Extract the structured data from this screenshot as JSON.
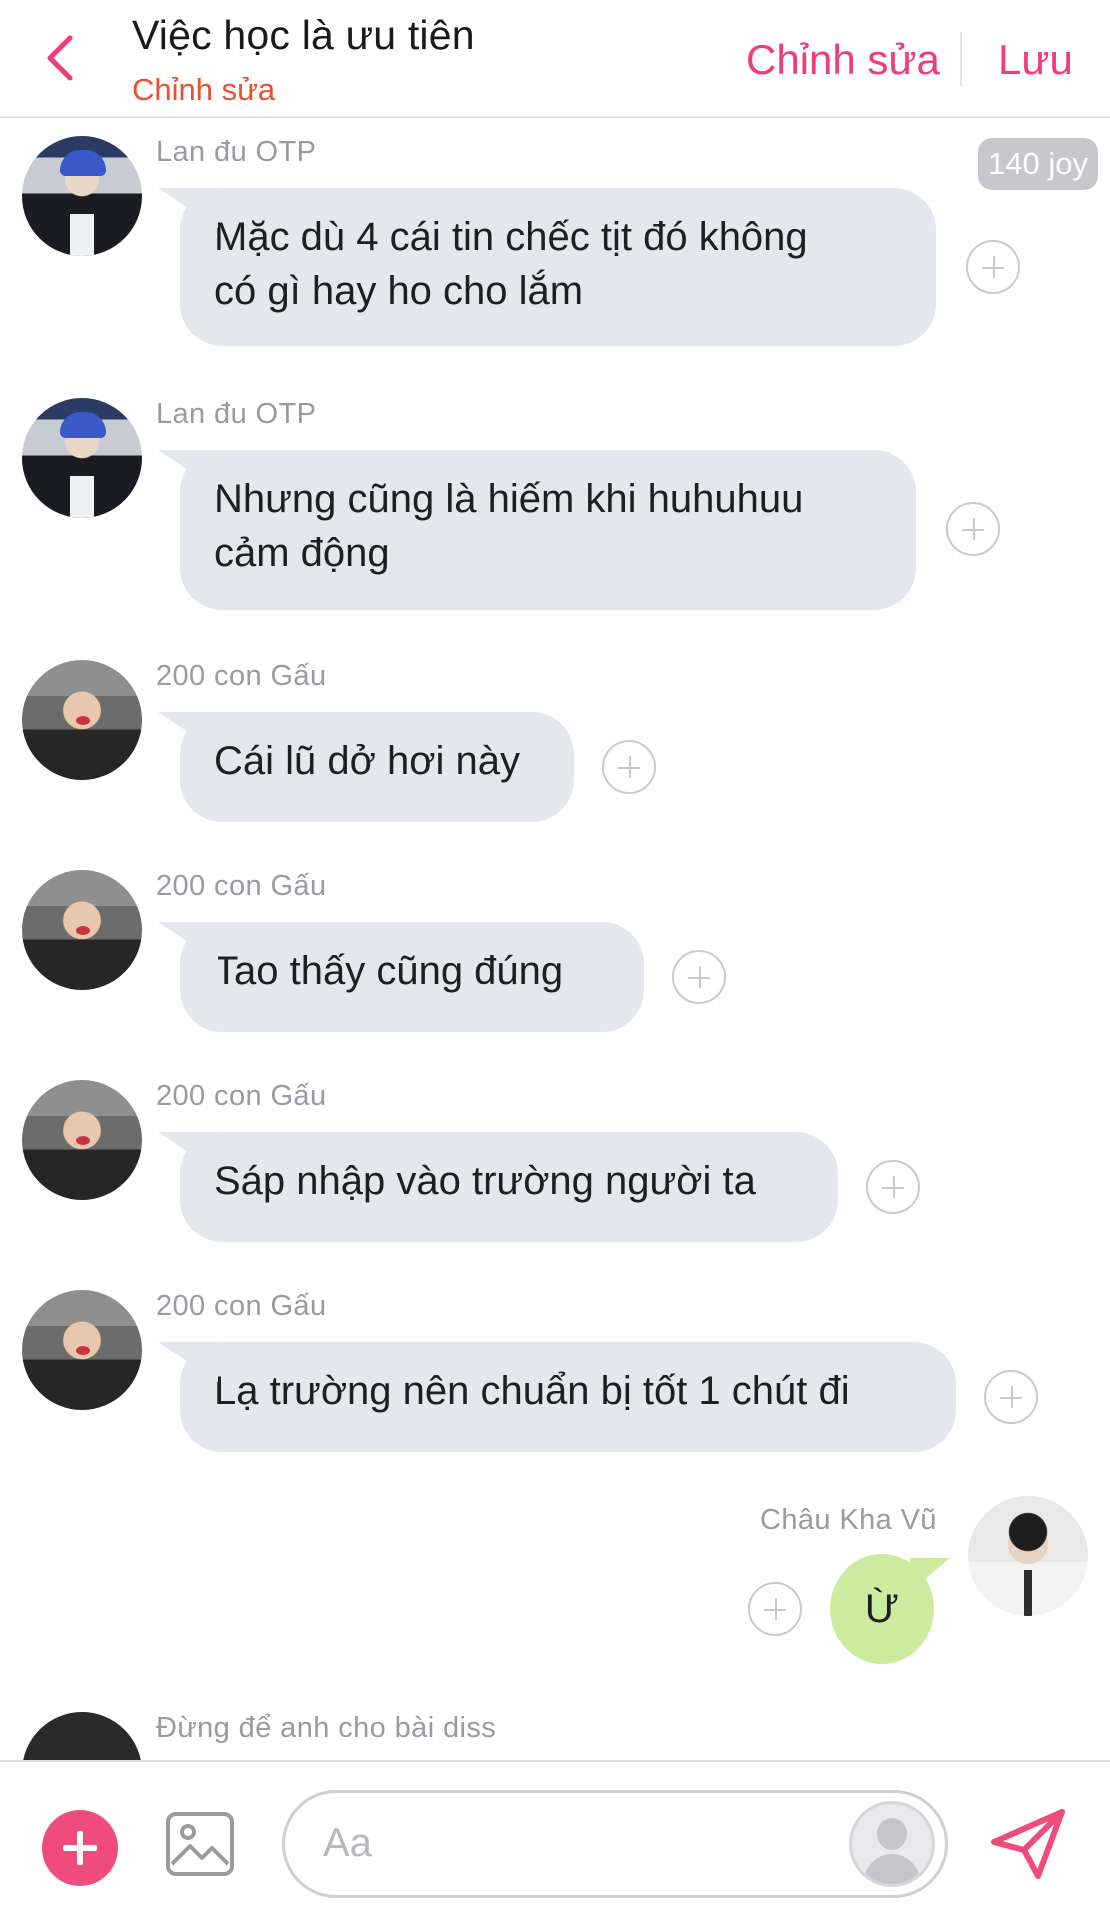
{
  "header": {
    "title": "Việc học là ưu tiên",
    "subtitle": "Chỉnh sửa",
    "edit_label": "Chỉnh sửa",
    "save_label": "Lưu"
  },
  "joy_badge": "140 joy",
  "messages": [
    {
      "sender": "Lan đu OTP",
      "lines": [
        "Mặc dù 4 cái tin chếc tịt đó không",
        "có gì hay ho cho lắm"
      ],
      "avatar": "avatar-lan-du-otp"
    },
    {
      "sender": "Lan đu OTP",
      "lines": [
        "Nhưng cũng là hiếm khi huhuhuu",
        "cảm động"
      ],
      "avatar": "avatar-lan-du-otp"
    },
    {
      "sender": "200 con Gấu",
      "lines": [
        "Cái lũ dở hơi này"
      ],
      "avatar": "avatar-200-con-gau"
    },
    {
      "sender": "200 con Gấu",
      "lines": [
        "Tao thấy cũng đúng"
      ],
      "avatar": "avatar-200-con-gau"
    },
    {
      "sender": "200 con Gấu",
      "lines": [
        "Sáp nhập vào trường người ta"
      ],
      "avatar": "avatar-200-con-gau"
    },
    {
      "sender": "200 con Gấu",
      "lines": [
        "Lạ trường nên chuẩn bị tốt 1 chút đi"
      ],
      "avatar": "avatar-200-con-gau"
    },
    {
      "sender": "Châu Kha Vũ",
      "lines": [
        "Ừ"
      ],
      "avatar": "avatar-chau-kha-vu",
      "outgoing": true
    },
    {
      "sender": "Đừng để anh cho bài diss",
      "lines": [],
      "avatar": "avatar-dung-de-anh"
    }
  ],
  "composer": {
    "placeholder": "Aa"
  },
  "icons": {
    "back": "chevron-left-icon",
    "add": "plus-icon",
    "image": "image-icon",
    "send": "send-icon",
    "react": "add-reaction-icon"
  },
  "colors": {
    "accent": "#f03b7d",
    "subtitle": "#e8502f",
    "bubble_in": "#e4e7ec",
    "bubble_out": "#cdeb9e"
  }
}
